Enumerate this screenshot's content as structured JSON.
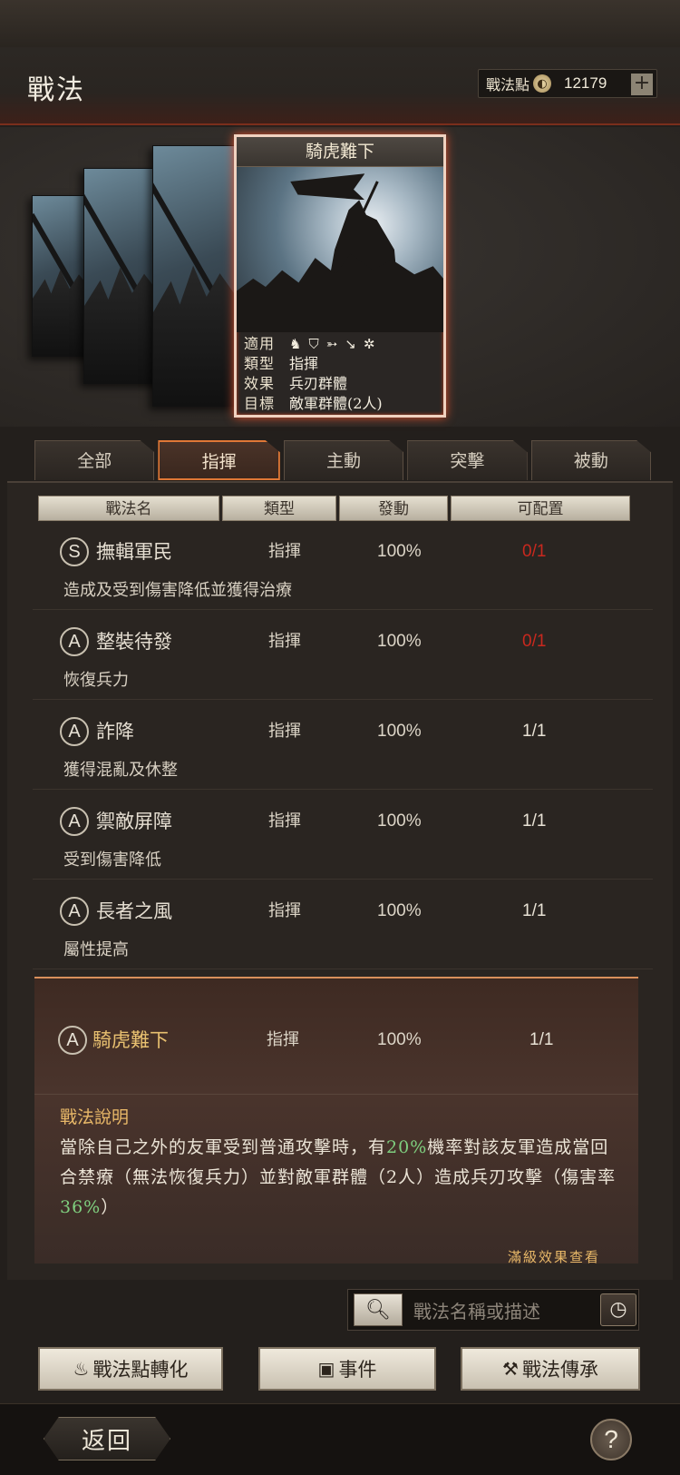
{
  "header": {
    "title": "戰法",
    "points_label": "戰法點",
    "points_icon": "coin-icon",
    "points_value": "12179",
    "plus": "+"
  },
  "card": {
    "title": "騎虎難下",
    "rows": [
      {
        "key": "適用",
        "val": ""
      },
      {
        "key": "類型",
        "val": "指揮"
      },
      {
        "key": "效果",
        "val": "兵刃群體"
      },
      {
        "key": "目標",
        "val": "敵軍群體(2人)"
      }
    ],
    "unit_icons": [
      "cavalry-icon",
      "shield-icon",
      "bow-icon",
      "spear-icon",
      "wheel-icon"
    ]
  },
  "tabs": [
    {
      "label": "全部"
    },
    {
      "label": "指揮"
    },
    {
      "label": "主動"
    },
    {
      "label": "突擊"
    },
    {
      "label": "被動"
    }
  ],
  "columns": [
    "戰法名",
    "類型",
    "發動",
    "可配置"
  ],
  "rows": [
    {
      "grade": "S",
      "name": "撫輯軍民",
      "type": "指揮",
      "rate": "100%",
      "config": "0/1",
      "desc": "造成及受到傷害降低並獲得治療"
    },
    {
      "grade": "A",
      "name": "整裝待發",
      "type": "指揮",
      "rate": "100%",
      "config": "0/1",
      "desc": "恢復兵力"
    },
    {
      "grade": "A",
      "name": "詐降",
      "type": "指揮",
      "rate": "100%",
      "config": "1/1",
      "desc": "獲得混亂及休整"
    },
    {
      "grade": "A",
      "name": "禦敵屏障",
      "type": "指揮",
      "rate": "100%",
      "config": "1/1",
      "desc": "受到傷害降低"
    },
    {
      "grade": "A",
      "name": "長者之風",
      "type": "指揮",
      "rate": "100%",
      "config": "1/1",
      "desc": "屬性提高"
    }
  ],
  "selected": {
    "grade": "A",
    "name": "騎虎難下",
    "type": "指揮",
    "rate": "100%",
    "config": "1/1",
    "detail_title": "戰法說明",
    "detail_p1": "當除自己之外的友軍受到普通攻擊時，有",
    "detail_pct1": "20%",
    "detail_p2": "機率對該友軍造成當回合禁療（無法恢復兵力）並對敵軍群體（2人）造成兵刃攻擊（傷害率",
    "detail_pct2": "36%",
    "detail_p3": "）",
    "more_link": "滿級效果查看"
  },
  "search": {
    "placeholder": "戰法名稱或描述",
    "search_icon": "magnifier-icon",
    "history_icon": "clock-icon"
  },
  "actions": {
    "convert": "戰法點轉化",
    "events": "事件",
    "inherit": "戰法傳承"
  },
  "footer": {
    "back": "返回",
    "help": "?"
  },
  "colors": {
    "accent": "#e07836",
    "highlight_green": "#7fcf7f",
    "warning_red": "#c8281e",
    "gold": "#e8b868"
  }
}
